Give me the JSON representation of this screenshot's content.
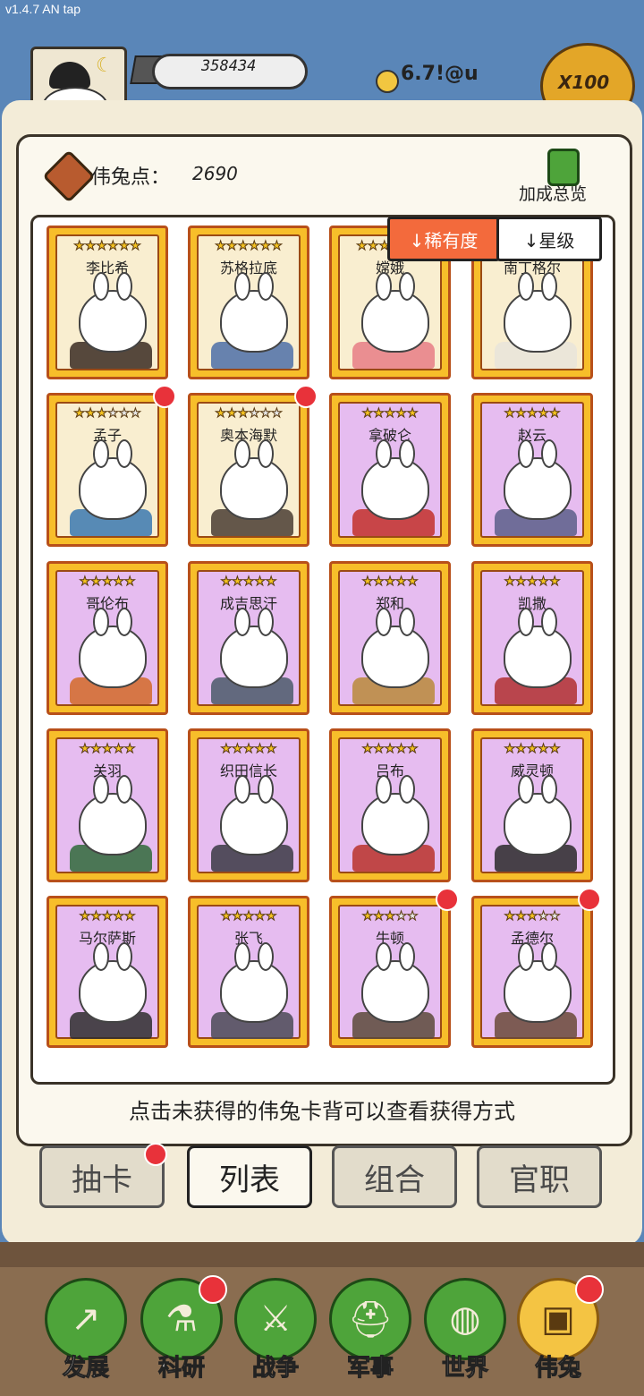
{
  "status_bar": {
    "version": "v1.4.7 AN tap"
  },
  "header": {
    "resource_value": "358434",
    "gold_value": "6.7!@u",
    "multiplier_label": "X100"
  },
  "panel": {
    "points_label": "伟兔点：",
    "points_value": "2690",
    "bonus_overview_label": "加成总览",
    "sort_rarity_label": "↓稀有度",
    "sort_star_label": "↓星级",
    "hint_text": "点击未获得的伟兔卡背可以查看获得方式"
  },
  "cards": [
    {
      "name": "李比希",
      "stars": 6,
      "max_stars": 6,
      "frame": "gold",
      "costume_color": "#3a2a22",
      "new": false
    },
    {
      "name": "苏格拉底",
      "stars": 6,
      "max_stars": 6,
      "frame": "gold",
      "costume_color": "#4d6fa8",
      "new": false
    },
    {
      "name": "嫦娥",
      "stars": 6,
      "max_stars": 6,
      "frame": "gold",
      "costume_color": "#e87c86",
      "new": false
    },
    {
      "name": "南丁格尔",
      "stars": 6,
      "max_stars": 6,
      "frame": "gold",
      "costume_color": "#e9e4da",
      "new": false
    },
    {
      "name": "孟子",
      "stars": 3,
      "max_stars": 6,
      "frame": "gold",
      "costume_color": "#3b78b0",
      "new": true
    },
    {
      "name": "奥本海默",
      "stars": 3,
      "max_stars": 6,
      "frame": "gold",
      "costume_color": "#4a3c32",
      "new": true
    },
    {
      "name": "拿破仑",
      "stars": 5,
      "max_stars": 5,
      "frame": "purple",
      "costume_color": "#c2302a",
      "new": false
    },
    {
      "name": "赵云",
      "stars": 5,
      "max_stars": 5,
      "frame": "purple",
      "costume_color": "#5b5f8a",
      "new": false
    },
    {
      "name": "哥伦布",
      "stars": 5,
      "max_stars": 5,
      "frame": "purple",
      "costume_color": "#d26a28",
      "new": false
    },
    {
      "name": "成吉思汗",
      "stars": 5,
      "max_stars": 5,
      "frame": "purple",
      "costume_color": "#4a5a6a",
      "new": false
    },
    {
      "name": "郑和",
      "stars": 5,
      "max_stars": 5,
      "frame": "purple",
      "costume_color": "#b98a3a",
      "new": false
    },
    {
      "name": "凯撒",
      "stars": 5,
      "max_stars": 5,
      "frame": "purple",
      "costume_color": "#b03030",
      "new": false
    },
    {
      "name": "关羽",
      "stars": 5,
      "max_stars": 5,
      "frame": "purple",
      "costume_color": "#2f6a3a",
      "new": false
    },
    {
      "name": "织田信长",
      "stars": 5,
      "max_stars": 5,
      "frame": "purple",
      "costume_color": "#3a3a44",
      "new": false
    },
    {
      "name": "吕布",
      "stars": 5,
      "max_stars": 5,
      "frame": "purple",
      "costume_color": "#b8322a",
      "new": false
    },
    {
      "name": "威灵顿",
      "stars": 5,
      "max_stars": 5,
      "frame": "purple",
      "costume_color": "#2a2a2a",
      "new": false
    },
    {
      "name": "马尔萨斯",
      "stars": 5,
      "max_stars": 5,
      "frame": "purple",
      "costume_color": "#2e2e2e",
      "new": false
    },
    {
      "name": "张飞",
      "stars": 5,
      "max_stars": 5,
      "frame": "purple",
      "costume_color": "#4a4a56",
      "new": false
    },
    {
      "name": "牛顿",
      "stars": 3,
      "max_stars": 5,
      "frame": "purple",
      "costume_color": "#5a4a3a",
      "new": true
    },
    {
      "name": "孟德尔",
      "stars": 3,
      "max_stars": 5,
      "frame": "purple",
      "costume_color": "#6a4a38",
      "new": true
    }
  ],
  "tabs": [
    {
      "label": "抽卡",
      "active": false,
      "badge": true
    },
    {
      "label": "列表",
      "active": true,
      "badge": false
    },
    {
      "label": "组合",
      "active": false,
      "badge": false
    },
    {
      "label": "官职",
      "active": false,
      "badge": false
    }
  ],
  "nav": [
    {
      "label": "发展",
      "icon": "growth-arrow-icon",
      "glyph": "↗",
      "active": false,
      "badge": false
    },
    {
      "label": "科研",
      "icon": "flask-icon",
      "glyph": "⚗",
      "active": false,
      "badge": true
    },
    {
      "label": "战争",
      "icon": "crossed-swords-icon",
      "glyph": "⚔",
      "active": false,
      "badge": false
    },
    {
      "label": "军事",
      "icon": "helmet-icon",
      "glyph": "⛑",
      "active": false,
      "badge": false
    },
    {
      "label": "世界",
      "icon": "globe-icon",
      "glyph": "◍",
      "active": false,
      "badge": false
    },
    {
      "label": "伟兔",
      "icon": "bunny-card-icon",
      "glyph": "▣",
      "active": true,
      "badge": true
    }
  ]
}
